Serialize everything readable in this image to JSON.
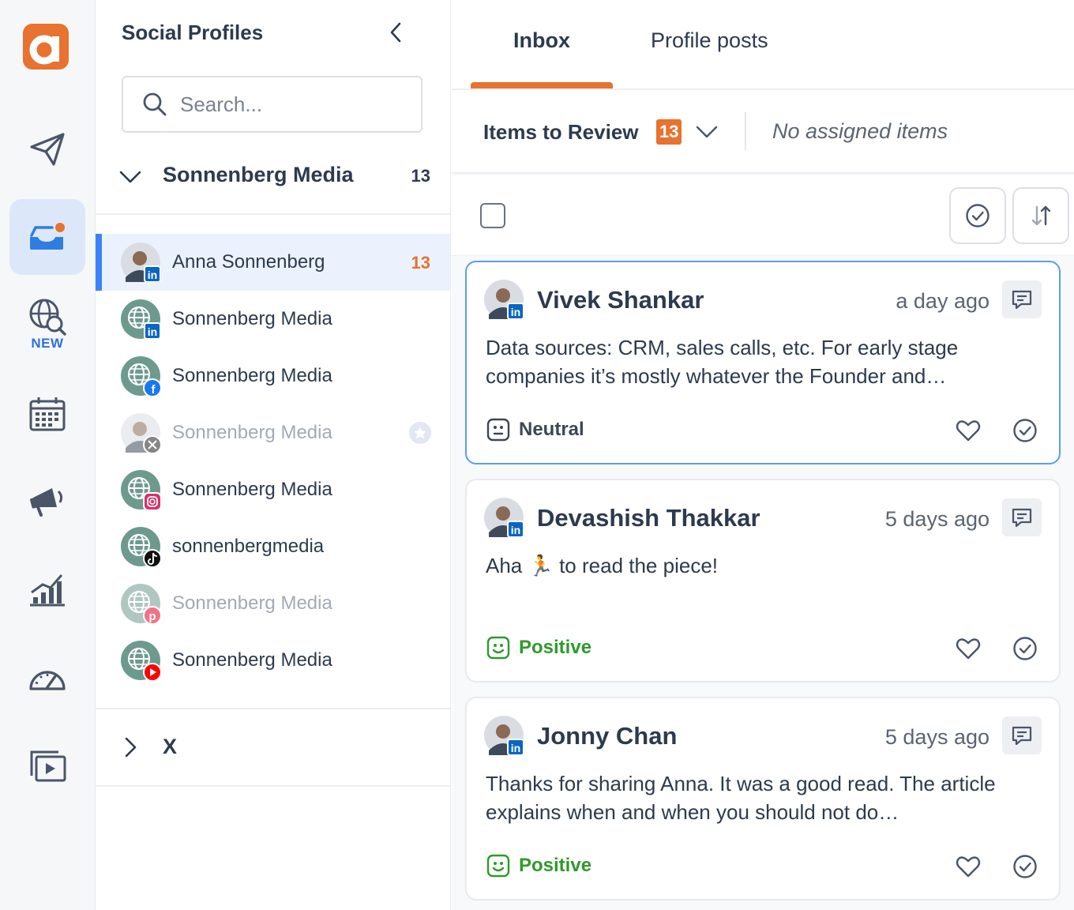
{
  "app": {
    "logo_icon": "brand-logo-a",
    "accent_color": "#e8722f",
    "active_color": "#3b82f6"
  },
  "rail": {
    "items": [
      {
        "name": "publish",
        "icon": "paper-plane-icon"
      },
      {
        "name": "inbox",
        "icon": "inbox-icon",
        "active": true
      },
      {
        "name": "listening",
        "icon": "globe-search-icon",
        "badge": "NEW"
      },
      {
        "name": "calendar",
        "icon": "calendar-icon"
      },
      {
        "name": "campaigns",
        "icon": "megaphone-icon"
      },
      {
        "name": "analytics",
        "icon": "chart-icon"
      },
      {
        "name": "dashboard",
        "icon": "gauge-icon"
      },
      {
        "name": "media",
        "icon": "media-library-icon"
      }
    ]
  },
  "profiles_panel": {
    "title": "Social Profiles",
    "search_placeholder": "Search...",
    "group": {
      "name": "Sonnenberg Media",
      "count": "13",
      "expanded": true
    },
    "profiles": [
      {
        "name": "Anna Sonnenberg",
        "network": "linkedin",
        "count": "13",
        "active": true
      },
      {
        "name": "Sonnenberg Media",
        "network": "linkedin"
      },
      {
        "name": "Sonnenberg Media",
        "network": "facebook"
      },
      {
        "name": "Sonnenberg Media",
        "network": "x",
        "dim": true,
        "upgrade_icon": "star-icon"
      },
      {
        "name": "Sonnenberg Media",
        "network": "instagram"
      },
      {
        "name": "sonnenbergmedia",
        "network": "tiktok"
      },
      {
        "name": "Sonnenberg Media",
        "network": "pinterest",
        "dim": true
      },
      {
        "name": "Sonnenberg Media",
        "network": "youtube"
      }
    ],
    "group2": {
      "name": "X",
      "expanded": false
    }
  },
  "main": {
    "tabs": [
      {
        "label": "Inbox",
        "active": true
      },
      {
        "label": "Profile posts"
      }
    ],
    "filter": {
      "label": "Items to Review",
      "badge": "13",
      "note": "No assigned items"
    },
    "cards": [
      {
        "author": "Vivek Shankar",
        "time": "a day ago",
        "text": "Data sources: CRM, sales calls, etc. For early stage companies it’s mostly whatever the Founder and…",
        "sentiment": "Neutral",
        "selected": true
      },
      {
        "author": "Devashish Thakkar",
        "time": "5 days ago",
        "text": "Aha 🏃 to read the piece!",
        "sentiment": "Positive"
      },
      {
        "author": "Jonny Chan",
        "time": "5 days ago",
        "text": "Thanks for sharing Anna. It was a good read. The article explains when and when you should not do…",
        "sentiment": "Positive"
      }
    ]
  }
}
